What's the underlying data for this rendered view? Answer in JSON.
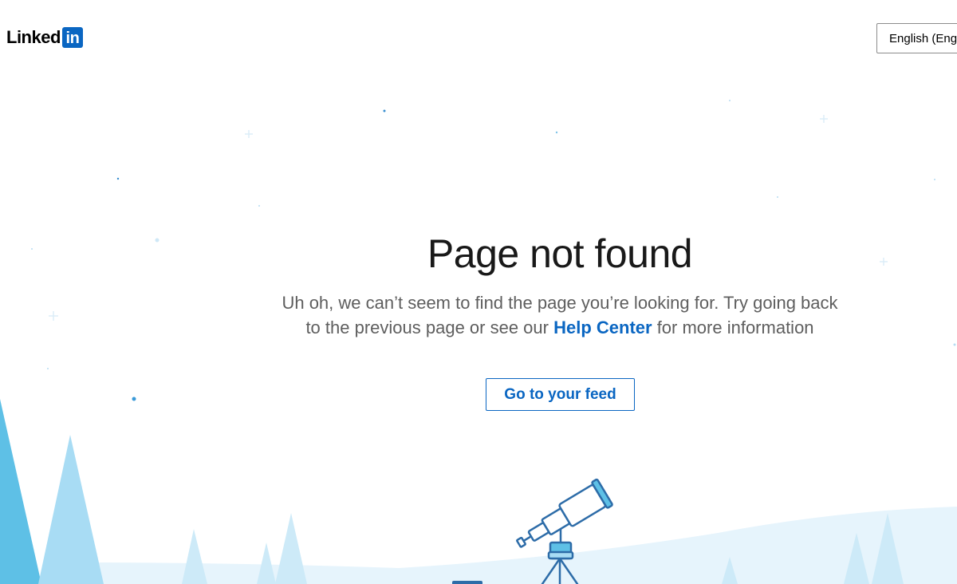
{
  "header": {
    "logo_text": "Linked",
    "logo_box_text": "in",
    "language_select_value": "English (English)"
  },
  "main": {
    "title": "Page not found",
    "message_before": "Uh oh, we can’t seem to find the page you’re looking for. Try going back to the previous page or see our ",
    "help_link_label": "Help Center",
    "message_after": " for more information",
    "feed_button_label": "Go to your feed"
  },
  "colors": {
    "brand_blue": "#0a66c2",
    "tree_blue_dark": "#5ec0e6",
    "tree_blue_light": "#a8dcf4",
    "hill_blue": "#e6f4fc",
    "telescope_stroke": "#2d6ca8"
  },
  "icons": {
    "logo": "linkedin-logo",
    "illustration": "telescope-illustration"
  }
}
